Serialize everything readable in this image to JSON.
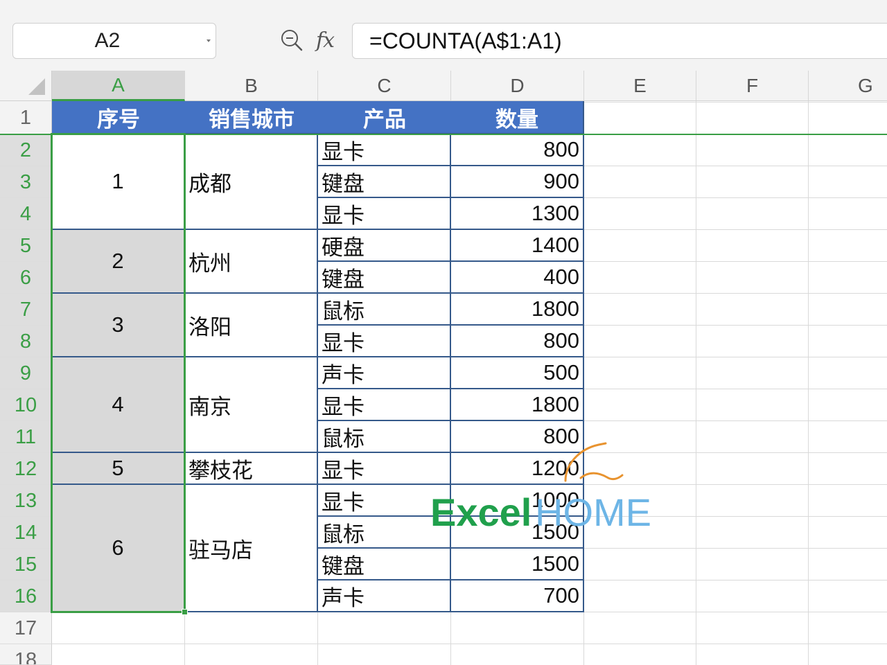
{
  "name_box": {
    "value": "A2"
  },
  "formula_bar": {
    "fx_label": "fx",
    "formula": "=COUNTA(A$1:A1)"
  },
  "column_headers": [
    "A",
    "B",
    "C",
    "D",
    "E",
    "F",
    "G"
  ],
  "row_headers": [
    "1",
    "2",
    "3",
    "4",
    "5",
    "6",
    "7",
    "8",
    "9",
    "10",
    "11",
    "12",
    "13",
    "14",
    "15",
    "16",
    "17",
    "18"
  ],
  "table": {
    "header": {
      "serial": "序号",
      "city": "销售城市",
      "product": "产品",
      "quantity": "数量"
    },
    "serial_numbers": [
      1,
      2,
      3,
      4,
      5,
      6
    ],
    "cities": [
      "成都",
      "杭州",
      "洛阳",
      "南京",
      "攀枝花",
      "驻马店"
    ],
    "products": [
      "显卡",
      "键盘",
      "显卡",
      "硬盘",
      "键盘",
      "鼠标",
      "显卡",
      "声卡",
      "显卡",
      "鼠标",
      "显卡",
      "显卡",
      "鼠标",
      "键盘",
      "声卡"
    ],
    "quantities": [
      800,
      900,
      1300,
      1400,
      400,
      1800,
      800,
      500,
      1800,
      800,
      1200,
      1000,
      1500,
      1500,
      700
    ]
  },
  "watermark": {
    "brand_left": "Excel",
    "brand_right": "HOME"
  },
  "icons": {
    "zoom": "zoom-out-icon",
    "name_box_dropdown": "chevron-down-icon",
    "select_all": "select-all-triangle-icon"
  },
  "colors": {
    "selection_green": "#3a9e45",
    "header_blue": "#4472c4",
    "table_border": "#35598a",
    "watermark_excel": "#20a04c",
    "watermark_home": "#6db5e6",
    "watermark_swoosh": "#e8932f"
  }
}
